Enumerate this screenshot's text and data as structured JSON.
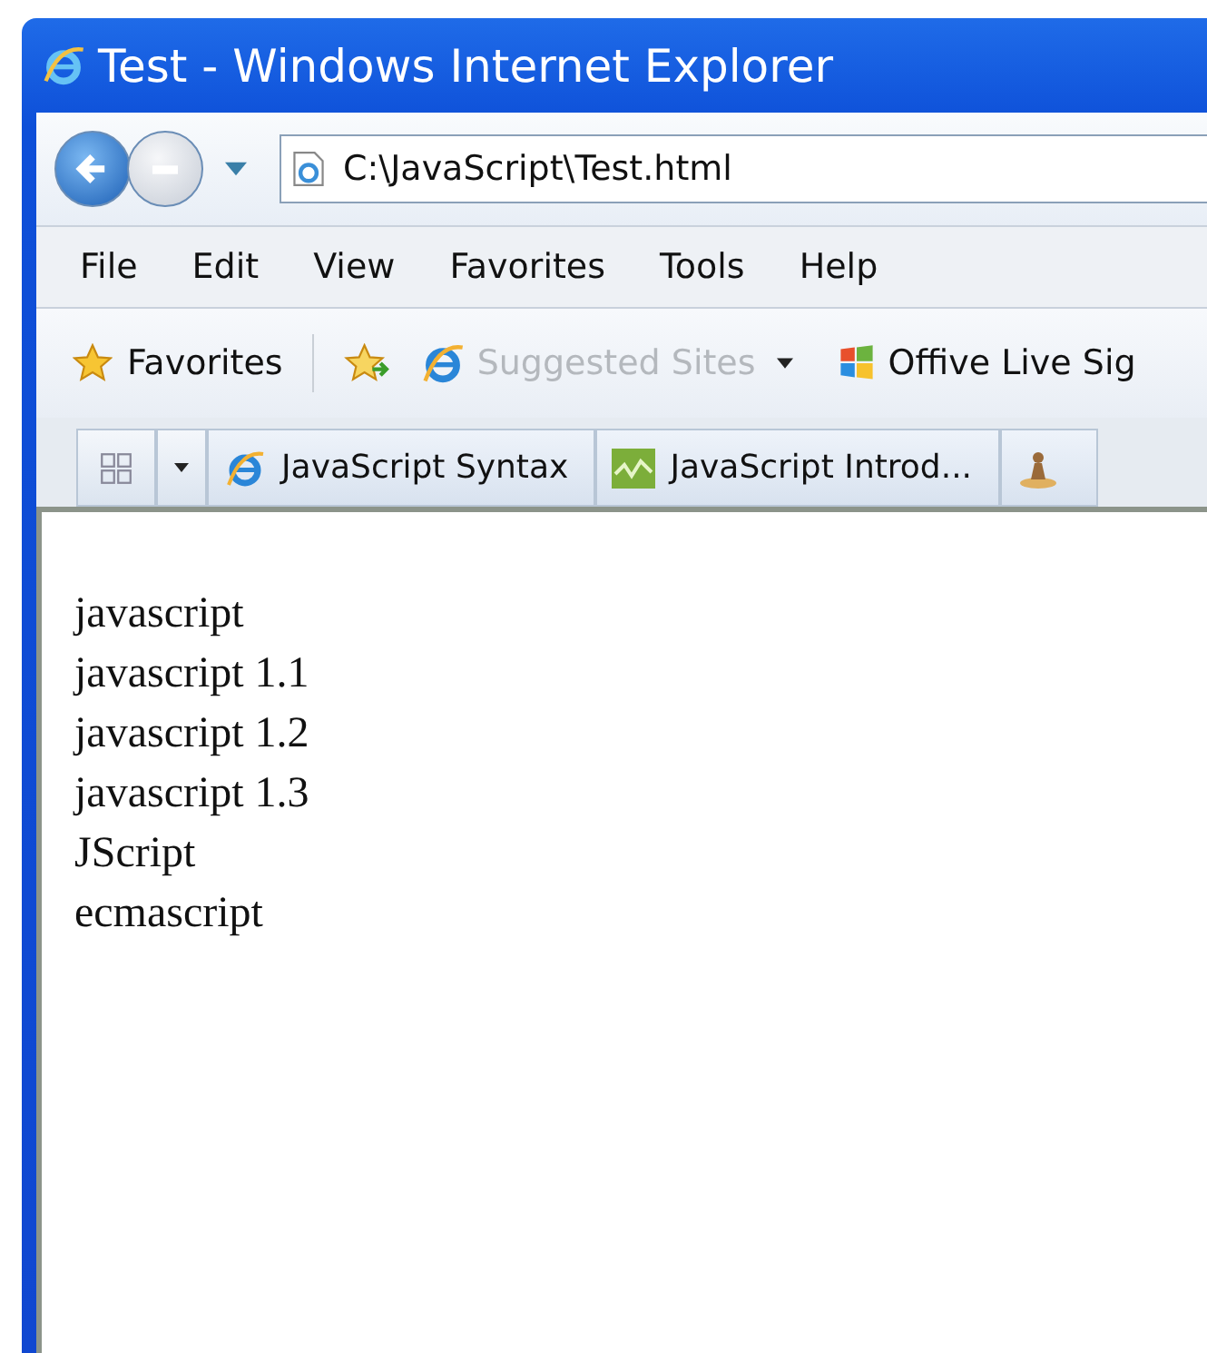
{
  "window": {
    "title": "Test - Windows Internet Explorer"
  },
  "address_bar": {
    "value": "C:\\JavaScript\\Test.html"
  },
  "menu": [
    {
      "label": "File"
    },
    {
      "label": "Edit"
    },
    {
      "label": "View"
    },
    {
      "label": "Favorites"
    },
    {
      "label": "Tools"
    },
    {
      "label": "Help"
    }
  ],
  "favorites_bar": {
    "favorites_label": "Favorites",
    "links": [
      {
        "label": "Suggested Sites",
        "disabled": true,
        "kind": "ie"
      },
      {
        "label": "Offive Live Sig",
        "disabled": false,
        "kind": "windows"
      }
    ]
  },
  "tabs": [
    {
      "label": "JavaScript Syntax",
      "kind": "ie"
    },
    {
      "label": "JavaScript Introd...",
      "kind": "wave"
    },
    {
      "kind": "figure"
    }
  ],
  "content": {
    "lines": [
      "javascript",
      "javascript 1.1",
      "javascript 1.2",
      "javascript 1.3",
      "JScript",
      "ecmascript"
    ]
  }
}
